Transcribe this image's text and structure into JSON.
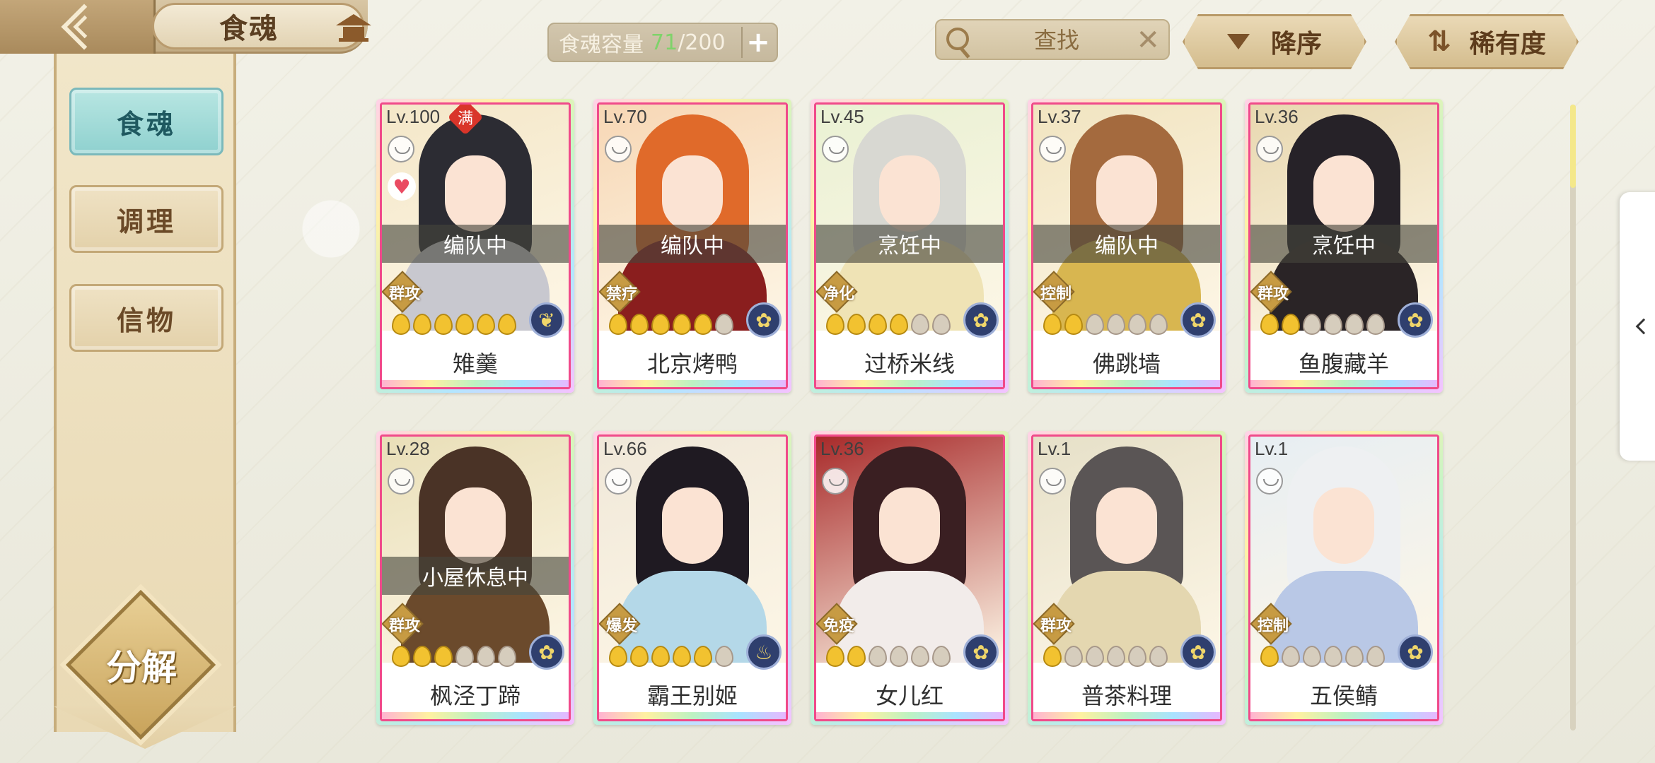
{
  "header": {
    "title": "食魂",
    "capacity": {
      "label": "食魂容量",
      "current": "71",
      "separator": "/",
      "max": "200",
      "add_label": "+"
    },
    "search": {
      "placeholder": "查找",
      "clear_label": "✕"
    },
    "sort_order_label": "降序",
    "sort_key_label": "稀有度",
    "colors": {
      "accent_teal": "#8fd1cf",
      "header_gold": "#c2ab83",
      "capacity_current": "#7fd36a"
    }
  },
  "sidebar": {
    "tabs": [
      {
        "label": "食魂",
        "active": true
      },
      {
        "label": "调理",
        "active": false
      },
      {
        "label": "信物",
        "active": false
      }
    ],
    "decompose_label": "分解"
  },
  "cards": [
    {
      "level": "Lv.100",
      "full_label": "满",
      "status": "编队中",
      "role": "群攻",
      "name": "雉羹",
      "stars_on": 6,
      "stars_total": 6,
      "favorite": true,
      "element_icon": "butterfly-icon",
      "palette": {
        "hair": "#2c2c33",
        "body": "#c8c8cf",
        "bg": "#f4e7c8"
      }
    },
    {
      "level": "Lv.70",
      "full_label": "",
      "status": "编队中",
      "role": "禁疗",
      "name": "北京烤鸭",
      "stars_on": 5,
      "stars_total": 6,
      "favorite": false,
      "element_icon": "flower-icon",
      "palette": {
        "hair": "#e06a2a",
        "body": "#8a1e1e",
        "bg": "#f7d7b5"
      }
    },
    {
      "level": "Lv.45",
      "full_label": "",
      "status": "烹饪中",
      "role": "净化",
      "name": "过桥米线",
      "stars_on": 4,
      "stars_total": 6,
      "favorite": false,
      "element_icon": "flower-icon",
      "palette": {
        "hair": "#d8d8d2",
        "body": "#efe3b5",
        "bg": "#e9f1d3"
      }
    },
    {
      "level": "Lv.37",
      "full_label": "",
      "status": "编队中",
      "role": "控制",
      "name": "佛跳墙",
      "stars_on": 2,
      "stars_total": 6,
      "favorite": false,
      "element_icon": "flower-icon",
      "palette": {
        "hair": "#a46a3e",
        "body": "#d8b650",
        "bg": "#f1e4c0"
      }
    },
    {
      "level": "Lv.36",
      "full_label": "",
      "status": "烹饪中",
      "role": "群攻",
      "name": "鱼腹藏羊",
      "stars_on": 2,
      "stars_total": 6,
      "favorite": false,
      "element_icon": "flower-icon",
      "palette": {
        "hair": "#262228",
        "body": "#2a2426",
        "bg": "#e8d8b0"
      }
    },
    {
      "level": "Lv.28",
      "full_label": "",
      "status": "小屋休息中",
      "role": "群攻",
      "name": "枫泾丁蹄",
      "stars_on": 3,
      "stars_total": 6,
      "favorite": false,
      "element_icon": "flower-icon",
      "palette": {
        "hair": "#4a3326",
        "body": "#6b4a2c",
        "bg": "#e9dfb8"
      }
    },
    {
      "level": "Lv.66",
      "full_label": "",
      "status": "",
      "role": "爆发",
      "name": "霸王别姬",
      "stars_on": 5,
      "stars_total": 6,
      "favorite": false,
      "element_icon": "flame-icon",
      "palette": {
        "hair": "#1f1a22",
        "body": "#b4d8e8",
        "bg": "#f0e8d9"
      }
    },
    {
      "level": "Lv.36",
      "full_label": "",
      "status": "",
      "role": "免疫",
      "name": "女儿红",
      "stars_on": 2,
      "stars_total": 6,
      "favorite": false,
      "element_icon": "flower-icon",
      "palette": {
        "hair": "#3a1f22",
        "body": "#f2ecea",
        "bg": "#a82a2a"
      }
    },
    {
      "level": "Lv.1",
      "full_label": "",
      "status": "",
      "role": "群攻",
      "name": "普茶料理",
      "stars_on": 1,
      "stars_total": 6,
      "favorite": false,
      "element_icon": "flower-icon",
      "palette": {
        "hair": "#5a5555",
        "body": "#e4d7b0",
        "bg": "#e6e0c8"
      }
    },
    {
      "level": "Lv.1",
      "full_label": "",
      "status": "",
      "role": "控制",
      "name": "五侯鲭",
      "stars_on": 1,
      "stars_total": 6,
      "favorite": false,
      "element_icon": "flower-icon",
      "palette": {
        "hair": "#eef0f2",
        "body": "#b9c8e6",
        "bg": "#e7eef3"
      }
    }
  ],
  "scroll": {
    "position_fraction": 0.0
  }
}
